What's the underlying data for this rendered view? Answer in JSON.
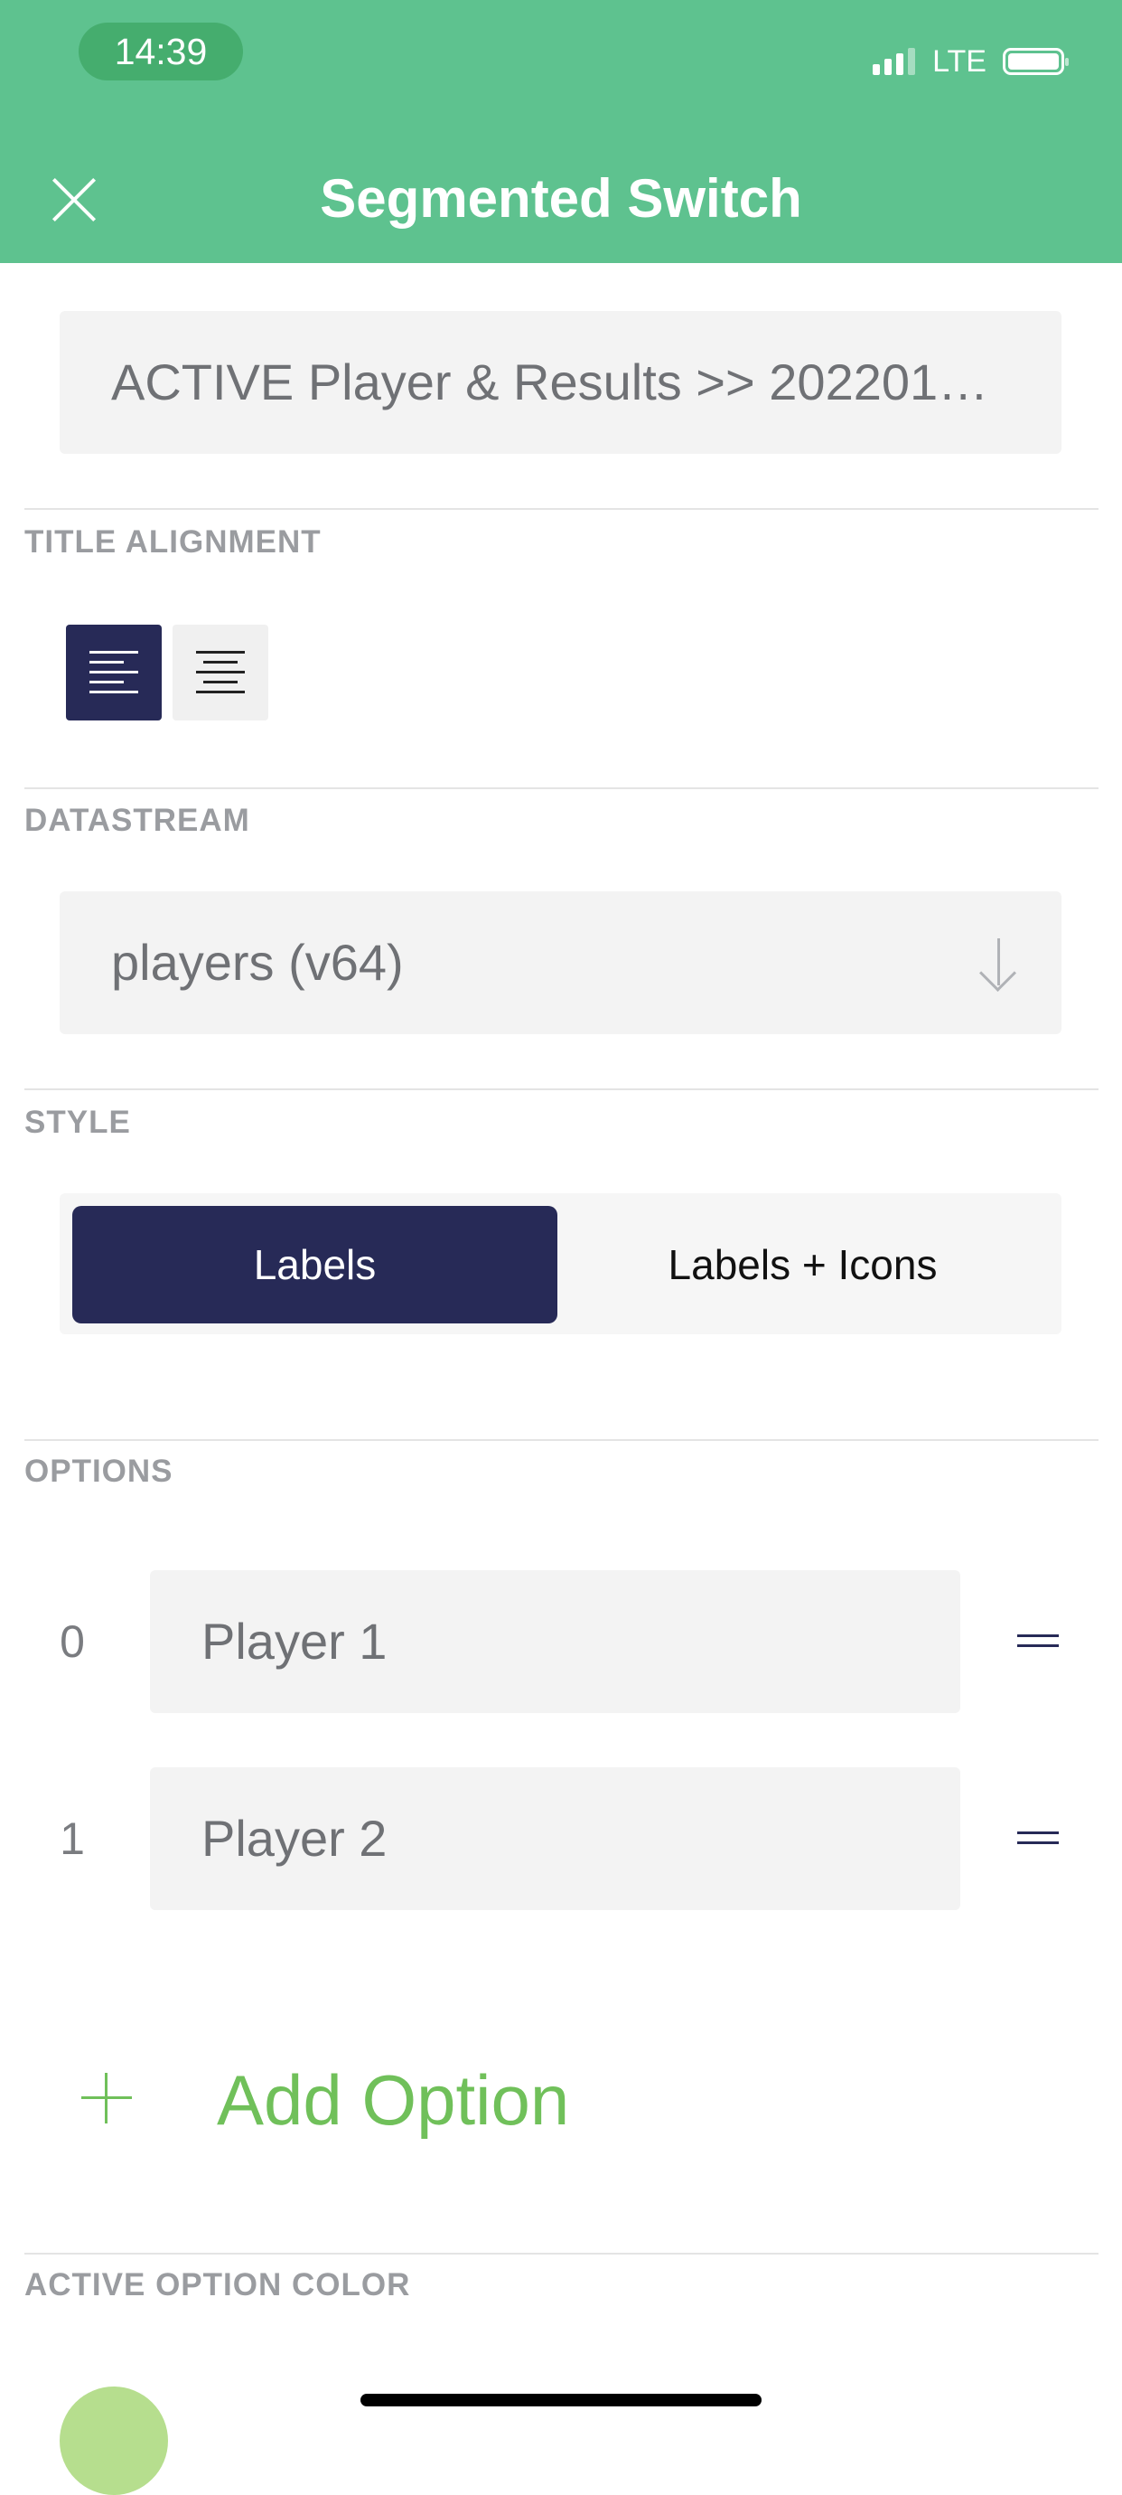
{
  "status_bar": {
    "time": "14:39",
    "network": "LTE"
  },
  "header": {
    "title": "Segmented Switch",
    "close_icon": "close-icon",
    "background_color": "#5ec28f"
  },
  "widget_title": {
    "value": "ACTIVE Player & Results >> 202201…"
  },
  "title_alignment": {
    "section_label": "TITLE ALIGNMENT",
    "options": [
      {
        "icon": "align-left-icon",
        "selected": true
      },
      {
        "icon": "align-center-icon",
        "selected": false
      }
    ]
  },
  "datastream": {
    "section_label": "DATASTREAM",
    "value": "players (v64)",
    "dropdown_icon": "arrow-down-icon"
  },
  "style": {
    "section_label": "STYLE",
    "options": [
      {
        "label": "Labels",
        "selected": true
      },
      {
        "label": "Labels + Icons",
        "selected": false
      }
    ]
  },
  "options": {
    "section_label": "OPTIONS",
    "items": [
      {
        "index": "0",
        "value": "Player 1"
      },
      {
        "index": "1",
        "value": "Player 2"
      }
    ],
    "add_label": "Add Option"
  },
  "active_option_color": {
    "section_label": "ACTIVE OPTION COLOR",
    "color": "#b6de8e"
  },
  "colors": {
    "accent_green": "#5ec28f",
    "navy": "#272a57",
    "add_green": "#70c05a"
  }
}
